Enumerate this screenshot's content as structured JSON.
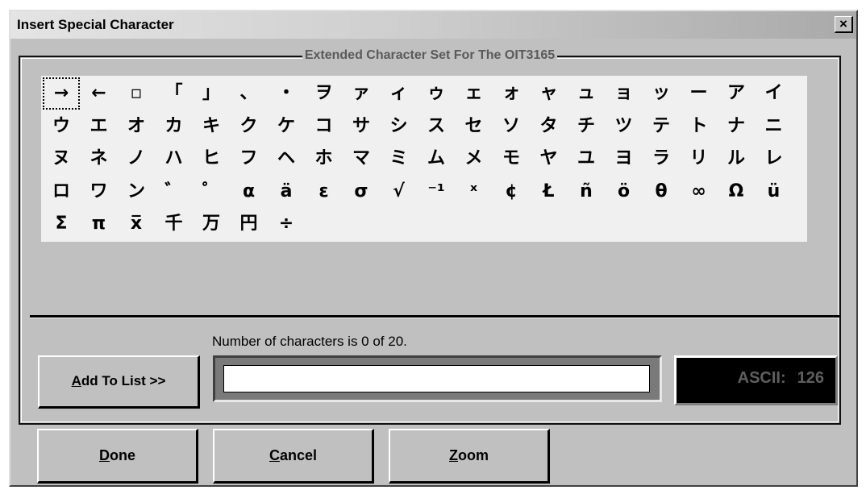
{
  "window": {
    "title": "Insert Special Character",
    "close_label": "×"
  },
  "group": {
    "label": "Extended Character Set For The OIT3165"
  },
  "character_rows": [
    [
      "→",
      "←",
      "▫",
      "「",
      "」",
      "、",
      "・",
      "ヲ",
      "ァ",
      "ィ",
      "ゥ",
      "ェ",
      "ォ",
      "ャ",
      "ュ",
      "ョ",
      "ッ",
      "ー",
      "ア",
      "イ"
    ],
    [
      "ウ",
      "エ",
      "オ",
      "カ",
      "キ",
      "ク",
      "ケ",
      "コ",
      "サ",
      "シ",
      "ス",
      "セ",
      "ソ",
      "タ",
      "チ",
      "ツ",
      "テ",
      "ト",
      "ナ",
      "ニ"
    ],
    [
      "ヌ",
      "ネ",
      "ノ",
      "ハ",
      "ヒ",
      "フ",
      "ヘ",
      "ホ",
      "マ",
      "ミ",
      "ム",
      "メ",
      "モ",
      "ヤ",
      "ユ",
      "ヨ",
      "ラ",
      "リ",
      "ル",
      "レ"
    ],
    [
      "ロ",
      "ワ",
      "ン",
      "゛",
      "゜",
      "α",
      "ä",
      "ε",
      "σ",
      "√",
      "⁻¹",
      "ˣ",
      "¢",
      "Ł",
      "ñ",
      "ö",
      "θ",
      "∞",
      "Ω",
      "ü"
    ],
    [
      "Σ",
      "π",
      "x̅",
      "千",
      "万",
      "円",
      "÷"
    ]
  ],
  "selected_character": "→",
  "counter": {
    "text": "Number of characters is 0 of 20."
  },
  "add_button": {
    "prefix": "A",
    "rest": "dd To List >>"
  },
  "text_field": {
    "value": "",
    "placeholder": ""
  },
  "ascii": {
    "label": "ASCII:",
    "value": "126"
  },
  "buttons": {
    "done": {
      "prefix": "D",
      "rest": "one"
    },
    "cancel": {
      "prefix": "C",
      "rest": "ancel"
    },
    "zoom": {
      "prefix": "Z",
      "rest": "oom"
    }
  }
}
